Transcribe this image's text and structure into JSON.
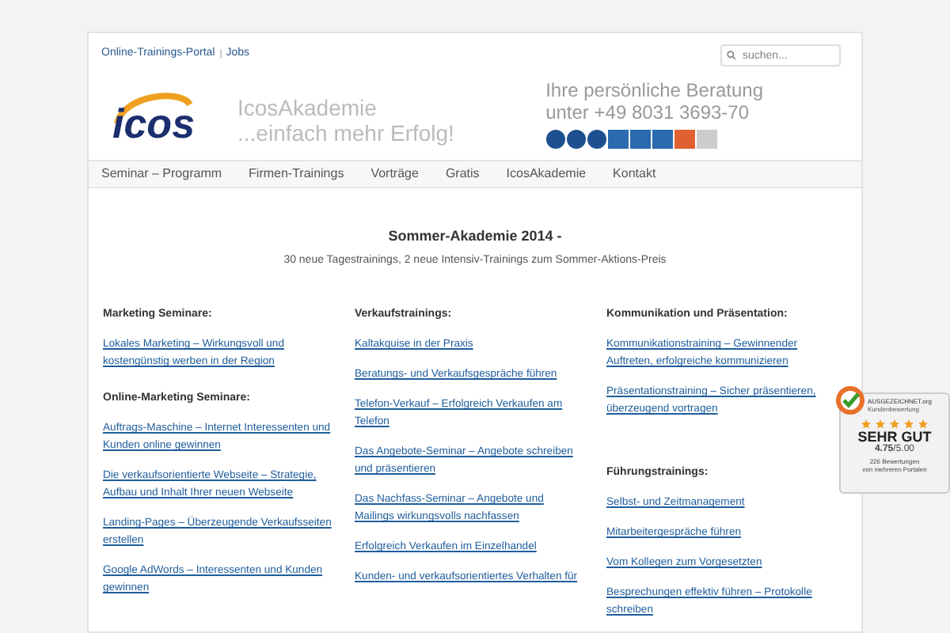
{
  "top_links": [
    "Online-Trainings-Portal",
    "Jobs"
  ],
  "search": {
    "placeholder": "suchen..."
  },
  "logo": {
    "text": "icos"
  },
  "brand": {
    "name": "IcosAkademie",
    "slogan": "...einfach mehr Erfolg!"
  },
  "contact": {
    "line1": "Ihre persönliche Beratung",
    "line2": "unter +49 8031 3693-70"
  },
  "nav": [
    {
      "label": "Seminar – Programm",
      "selected": false
    },
    {
      "label": "Firmen-Trainings",
      "selected": false
    },
    {
      "label": "Vorträge",
      "selected": false
    },
    {
      "label": "Gratis",
      "selected": false
    },
    {
      "label": "IcosAkademie",
      "selected": false
    },
    {
      "label": "Kontakt",
      "selected": false
    }
  ],
  "intro": {
    "title": "Sommer-Akademie 2014 -",
    "subtitle": "30 neue Tagestrainings, 2 neue Intensiv-Trainings zum Sommer-Aktions-Preis"
  },
  "columns": [
    {
      "sections": [
        {
          "heading": "Marketing Seminare:",
          "links": [
            "Lokales Marketing – Wirkungsvoll und kostengünstig werben in der Region"
          ]
        },
        {
          "heading": "Online-Marketing Seminare:",
          "links": [
            "Auftrags-Maschine – Internet Interessenten und Kunden online gewinnen",
            "Die verkaufsorientierte Webseite – Strategie, Aufbau und Inhalt Ihrer neuen Webseite",
            "Landing-Pages – Überzeugende Verkaufsseiten erstellen",
            "Google AdWords – Interessenten und Kunden gewinnen"
          ]
        }
      ]
    },
    {
      "sections": [
        {
          "heading": "Verkaufstrainings:",
          "links": [
            "Kaltakquise in der Praxis",
            "Beratungs- und Verkaufsgespräche führen",
            "Telefon-Verkauf – Erfolgreich Verkaufen am Telefon",
            "Das Angebote-Seminar – Angebote schreiben und präsentieren",
            "Das Nachfass-Seminar – Angebote und Mailings wirkungsvolls nachfassen",
            "Erfolgreich Verkaufen im Einzelhandel",
            "Kunden- und verkaufsorientiertes Verhalten für"
          ]
        }
      ]
    },
    {
      "sections": [
        {
          "heading": "Kommunikation und Präsentation:",
          "links": [
            "Kommunikationstraining – Gewinnender Auftreten, erfolgreiche kommunizieren",
            "Präsentationstraining – Sicher präsentieren, überzeugend vortragen"
          ]
        },
        {
          "heading": "Führungstrainings:",
          "links": [
            "Selbst- und Zeitmanagement",
            "Mitarbeitergespräche führen",
            "Vom Kollegen zum Vorgesetzten",
            "Besprechungen effektiv führen – Protokolle schreiben"
          ]
        }
      ]
    }
  ],
  "rating_badge": {
    "label": "AUSGEZEICHNET.org",
    "sublabel": "Kundenbewertung",
    "stars": 5,
    "verdict": "SEHR GUT",
    "score": "**4.75**/5.00",
    "count": "226 Bewertungen",
    "source": "von mehreren Portalen"
  }
}
